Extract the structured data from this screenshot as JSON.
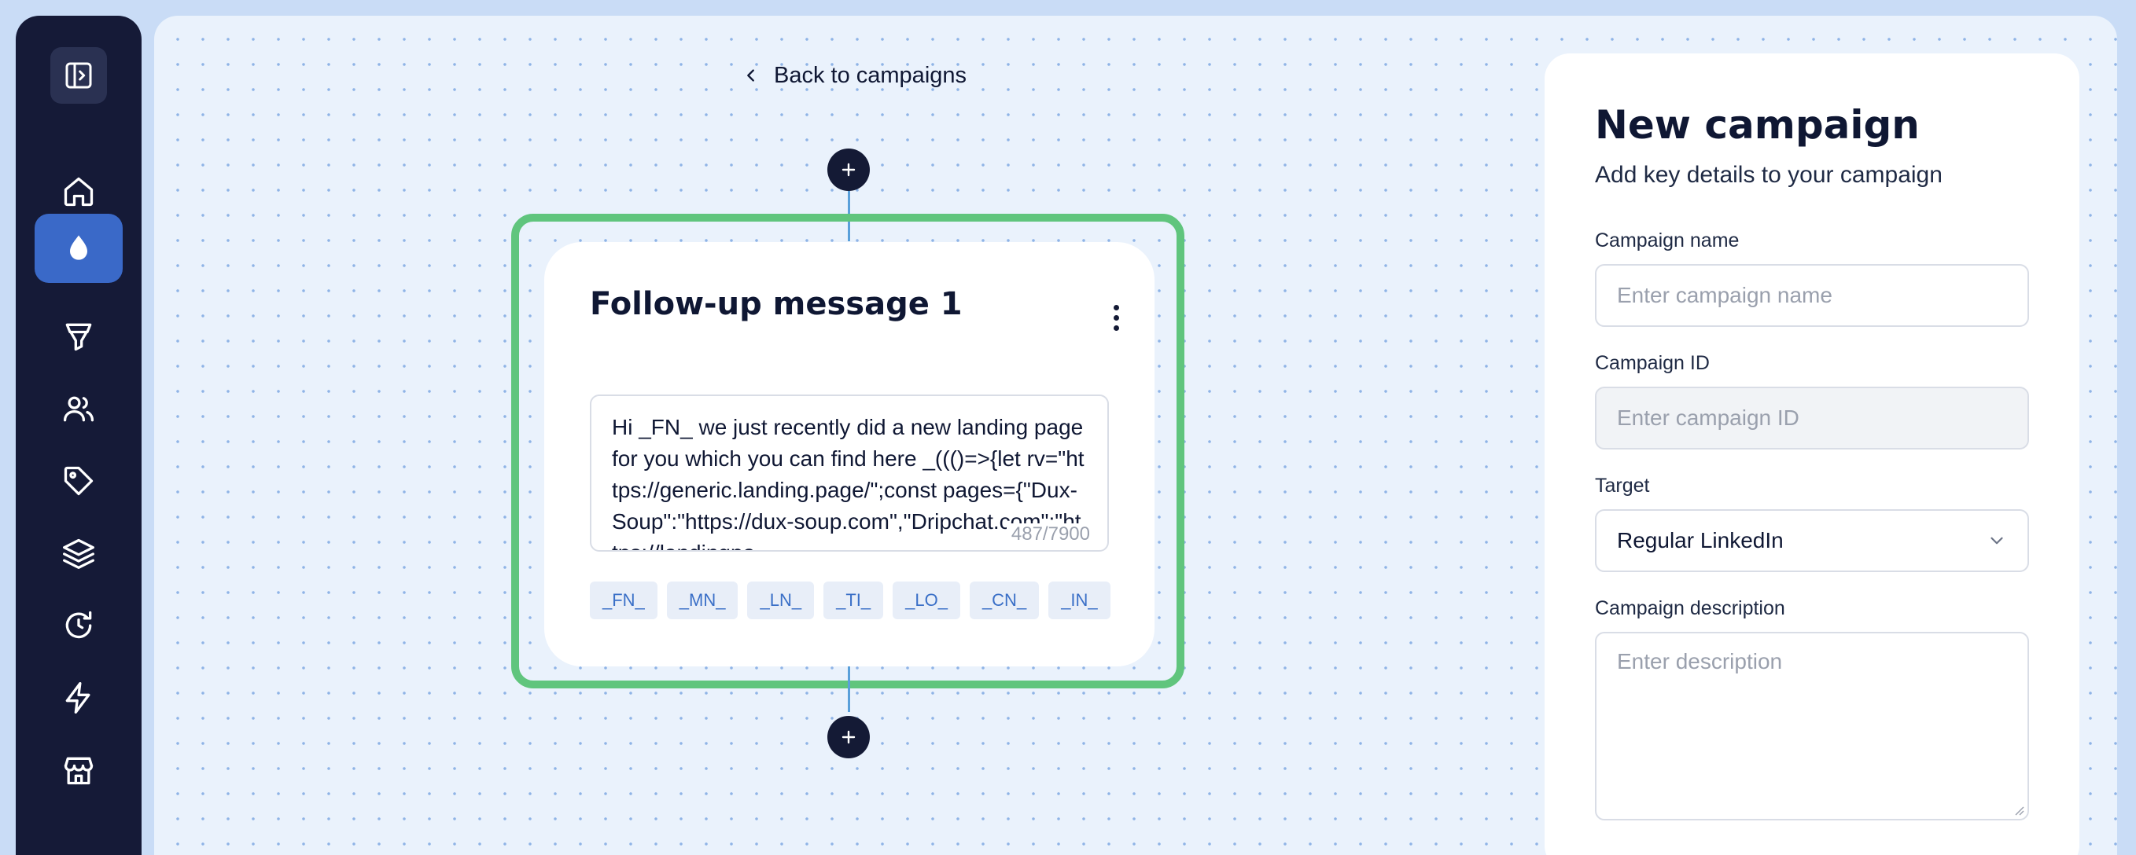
{
  "sidebar": {
    "toggle_icon": "sidebar-toggle-icon",
    "items": [
      {
        "name": "home",
        "icon": "home-icon",
        "active": false
      },
      {
        "name": "campaigns",
        "icon": "drop-icon",
        "active": true
      },
      {
        "name": "funnel",
        "icon": "funnel-icon",
        "active": false
      },
      {
        "name": "contacts",
        "icon": "users-icon",
        "active": false
      },
      {
        "name": "tags",
        "icon": "tag-icon",
        "active": false
      },
      {
        "name": "layers",
        "icon": "layers-icon",
        "active": false
      },
      {
        "name": "history",
        "icon": "refresh-icon",
        "active": false
      },
      {
        "name": "automations",
        "icon": "lightning-icon",
        "active": false
      },
      {
        "name": "store",
        "icon": "store-icon",
        "active": false
      }
    ]
  },
  "canvas": {
    "back_label": "Back to campaigns",
    "card": {
      "title": "Follow-up message 1",
      "message": "Hi _FN_ we just recently did a new landing page for you which you can find here _((()=>{let rv=\"https://generic.landing.page/\";const pages={\"Dux-Soup\":\"https://dux-soup.com\",\"Dripchat.com\":\"https://landingpa",
      "char_count": "487/7900",
      "tokens": [
        "_FN_",
        "_MN_",
        "_LN_",
        "_TI_",
        "_LO_",
        "_CN_",
        "_IN_"
      ]
    }
  },
  "panel": {
    "title": "New campaign",
    "subtitle": "Add key details to your campaign",
    "name_label": "Campaign name",
    "name_placeholder": "Enter campaign name",
    "id_label": "Campaign ID",
    "id_placeholder": "Enter campaign ID",
    "target_label": "Target",
    "target_value": "Regular LinkedIn",
    "description_label": "Campaign description",
    "description_placeholder": "Enter description"
  },
  "colors": {
    "sidebar_bg": "#151a37",
    "active_item": "#3a69c8",
    "selection_border": "#60c57d",
    "token_text": "#3a6fc7"
  }
}
